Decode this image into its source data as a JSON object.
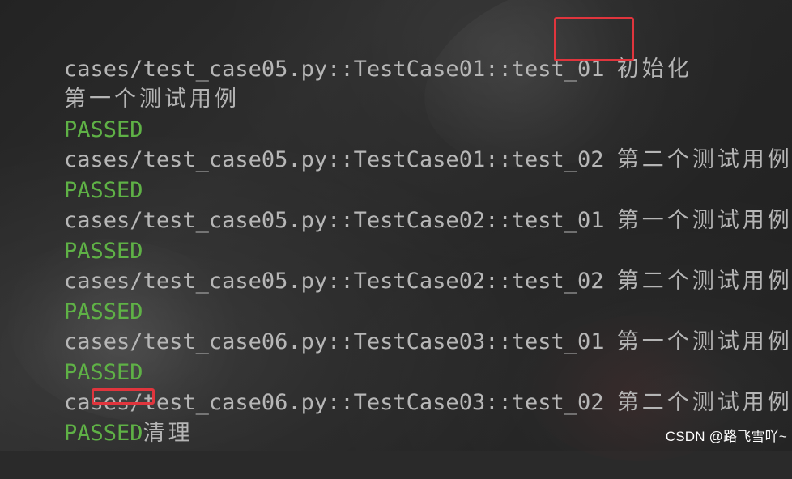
{
  "terminal": {
    "lines": [
      {
        "kind": "test",
        "path": "cases/test_case05.py::TestCase01::test_01",
        "desc": "初始化"
      },
      {
        "kind": "text",
        "text": "第一个测试用例"
      },
      {
        "kind": "status",
        "text": "PASSED"
      },
      {
        "kind": "test",
        "path": "cases/test_case05.py::TestCase01::test_02",
        "desc": "第二个测试用例"
      },
      {
        "kind": "status",
        "text": "PASSED"
      },
      {
        "kind": "test",
        "path": "cases/test_case05.py::TestCase02::test_01",
        "desc": "第一个测试用例"
      },
      {
        "kind": "status",
        "text": "PASSED"
      },
      {
        "kind": "test",
        "path": "cases/test_case05.py::TestCase02::test_02",
        "desc": "第二个测试用例"
      },
      {
        "kind": "status",
        "text": "PASSED"
      },
      {
        "kind": "test",
        "path": "cases/test_case06.py::TestCase03::test_01",
        "desc": "第一个测试用例"
      },
      {
        "kind": "status",
        "text": "PASSED"
      },
      {
        "kind": "test",
        "path": "cases/test_case06.py::TestCase03::test_02",
        "desc": "第二个测试用例"
      },
      {
        "kind": "status_with_text",
        "status": "PASSED",
        "text": "清理"
      }
    ]
  },
  "watermark": {
    "text": "CSDN @路飞雪吖~"
  },
  "colors": {
    "background": "#2a2a2a",
    "text": "#b7b7b7",
    "passed": "#5fb146",
    "highlight": "#e0353d",
    "watermark": "#ffffff"
  }
}
